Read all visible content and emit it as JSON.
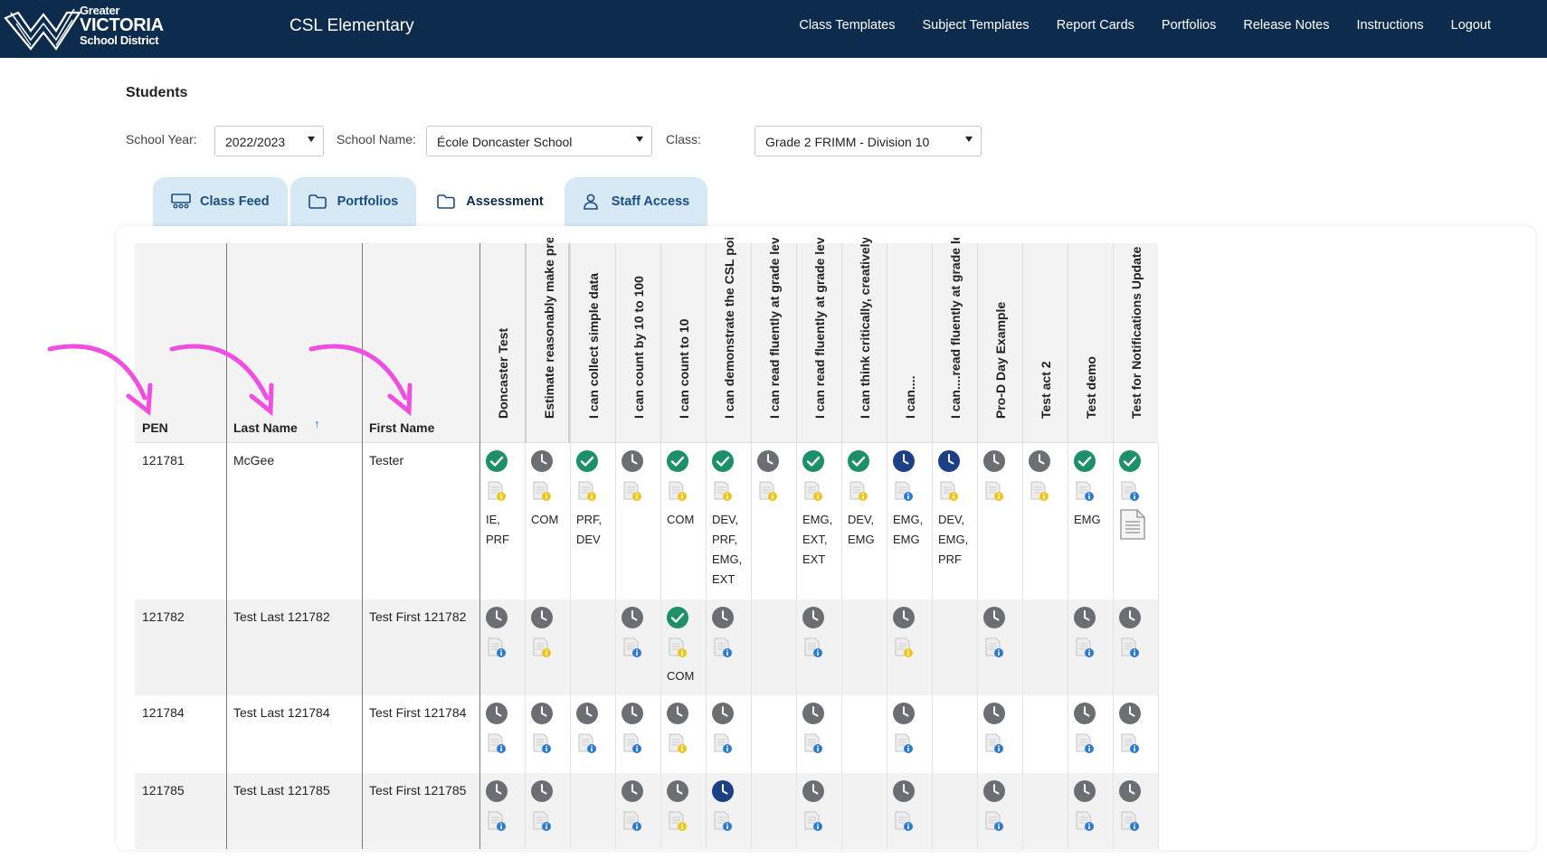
{
  "header": {
    "logo": {
      "line1": "Greater",
      "line2": "VICTORIA",
      "line3": "School District"
    },
    "app_title": "CSL Elementary",
    "nav": [
      "Class Templates",
      "Subject Templates",
      "Report Cards",
      "Portfolios",
      "Release Notes",
      "Instructions",
      "Logout"
    ]
  },
  "page": {
    "heading": "Students",
    "filters": {
      "school_year_label": "School Year:",
      "school_year_value": "2022/2023",
      "school_name_label": "School Name:",
      "school_name_value": "École Doncaster School",
      "class_label": "Class:",
      "class_value": "Grade 2 FRIMM - Division 10"
    }
  },
  "tabs": [
    {
      "label": "Class Feed",
      "icon": "class-feed-icon",
      "active": false
    },
    {
      "label": "Portfolios",
      "icon": "folder-icon",
      "active": false
    },
    {
      "label": "Assessment",
      "icon": "folder-icon",
      "active": true
    },
    {
      "label": "Staff Access",
      "icon": "person-icon",
      "active": false
    }
  ],
  "table": {
    "columns": {
      "pen": "PEN",
      "last_name": "Last Name",
      "first_name": "First Name",
      "sort_arrow": "↑"
    },
    "assessments": [
      "Doncaster Test",
      "Estimate reasonably make predictions",
      "I can collect simple data",
      "I can count by 10 to 100",
      "I can count to 10",
      "I can demonstrate the CSL points",
      "I can read fluently at grade level",
      "I can read fluently at grade level",
      "I can think critically, creatively",
      "I can....",
      "I can....read fluently at grade level",
      "Pro-D Day Example",
      "Test act 2",
      "Test demo",
      "Test for Notifications Update"
    ],
    "status_colors": {
      "done": "#1e9068",
      "pending": "#6b6f73",
      "active": "#1d3f86",
      "info_badge": "#2a7ad6",
      "note_badge": "#f2c318"
    },
    "rows": [
      {
        "pen": "121781",
        "last_name": "McGee",
        "first_name": "Tester",
        "cells": [
          {
            "status": "done",
            "doc": "note",
            "codes": "IE, PRF"
          },
          {
            "status": "pending",
            "doc": "note",
            "codes": "COM"
          },
          {
            "status": "done",
            "doc": "note",
            "codes": "PRF, DEV"
          },
          {
            "status": "pending",
            "doc": "note",
            "codes": ""
          },
          {
            "status": "done",
            "doc": "note",
            "codes": "COM"
          },
          {
            "status": "done",
            "doc": "note",
            "codes": "DEV, PRF, EMG, EXT"
          },
          {
            "status": "pending",
            "doc": "note",
            "codes": ""
          },
          {
            "status": "done",
            "doc": "note",
            "codes": "EMG, EXT, EXT"
          },
          {
            "status": "done",
            "doc": "note",
            "codes": "DEV, EMG"
          },
          {
            "status": "active",
            "doc": "info",
            "codes": "EMG, EMG"
          },
          {
            "status": "active",
            "doc": "note",
            "codes": "DEV, EMG, PRF"
          },
          {
            "status": "pending",
            "doc": "note",
            "codes": ""
          },
          {
            "status": "pending",
            "doc": "note",
            "codes": ""
          },
          {
            "status": "done",
            "doc": "info",
            "codes": "EMG"
          },
          {
            "status": "done",
            "doc": "info",
            "codes": "",
            "extra_doc": true
          }
        ]
      },
      {
        "pen": "121782",
        "last_name": "Test Last 121782",
        "first_name": "Test First 121782",
        "cells": [
          {
            "status": "pending",
            "doc": "info",
            "codes": ""
          },
          {
            "status": "pending",
            "doc": "note",
            "codes": ""
          },
          {
            "status": "none",
            "doc": "none",
            "codes": ""
          },
          {
            "status": "pending",
            "doc": "info",
            "codes": ""
          },
          {
            "status": "done",
            "doc": "note",
            "codes": "COM"
          },
          {
            "status": "pending",
            "doc": "info",
            "codes": ""
          },
          {
            "status": "none",
            "doc": "none",
            "codes": ""
          },
          {
            "status": "pending",
            "doc": "info",
            "codes": ""
          },
          {
            "status": "none",
            "doc": "none",
            "codes": ""
          },
          {
            "status": "pending",
            "doc": "note",
            "codes": ""
          },
          {
            "status": "none",
            "doc": "none",
            "codes": ""
          },
          {
            "status": "pending",
            "doc": "info",
            "codes": ""
          },
          {
            "status": "none",
            "doc": "none",
            "codes": ""
          },
          {
            "status": "pending",
            "doc": "info",
            "codes": ""
          },
          {
            "status": "pending",
            "doc": "info",
            "codes": ""
          }
        ]
      },
      {
        "pen": "121784",
        "last_name": "Test Last 121784",
        "first_name": "Test First 121784",
        "cells": [
          {
            "status": "pending",
            "doc": "info",
            "codes": ""
          },
          {
            "status": "pending",
            "doc": "info",
            "codes": ""
          },
          {
            "status": "pending",
            "doc": "info",
            "codes": ""
          },
          {
            "status": "pending",
            "doc": "info",
            "codes": ""
          },
          {
            "status": "pending",
            "doc": "note",
            "codes": ""
          },
          {
            "status": "pending",
            "doc": "info",
            "codes": ""
          },
          {
            "status": "none",
            "doc": "none",
            "codes": ""
          },
          {
            "status": "pending",
            "doc": "info",
            "codes": ""
          },
          {
            "status": "none",
            "doc": "none",
            "codes": ""
          },
          {
            "status": "pending",
            "doc": "info",
            "codes": ""
          },
          {
            "status": "none",
            "doc": "none",
            "codes": ""
          },
          {
            "status": "pending",
            "doc": "info",
            "codes": ""
          },
          {
            "status": "none",
            "doc": "none",
            "codes": ""
          },
          {
            "status": "pending",
            "doc": "info",
            "codes": ""
          },
          {
            "status": "pending",
            "doc": "info",
            "codes": ""
          }
        ]
      },
      {
        "pen": "121785",
        "last_name": "Test Last 121785",
        "first_name": "Test First 121785",
        "cells": [
          {
            "status": "pending",
            "doc": "info",
            "codes": ""
          },
          {
            "status": "pending",
            "doc": "info",
            "codes": ""
          },
          {
            "status": "none",
            "doc": "none",
            "codes": ""
          },
          {
            "status": "pending",
            "doc": "info",
            "codes": ""
          },
          {
            "status": "pending",
            "doc": "note",
            "codes": ""
          },
          {
            "status": "active",
            "doc": "info",
            "codes": ""
          },
          {
            "status": "none",
            "doc": "none",
            "codes": ""
          },
          {
            "status": "pending",
            "doc": "info",
            "codes": ""
          },
          {
            "status": "none",
            "doc": "none",
            "codes": ""
          },
          {
            "status": "pending",
            "doc": "info",
            "codes": ""
          },
          {
            "status": "none",
            "doc": "none",
            "codes": ""
          },
          {
            "status": "pending",
            "doc": "info",
            "codes": ""
          },
          {
            "status": "none",
            "doc": "none",
            "codes": ""
          },
          {
            "status": "pending",
            "doc": "info",
            "codes": ""
          },
          {
            "status": "pending",
            "doc": "info",
            "codes": ""
          }
        ]
      }
    ]
  },
  "annotation_color": "#f04ee0"
}
